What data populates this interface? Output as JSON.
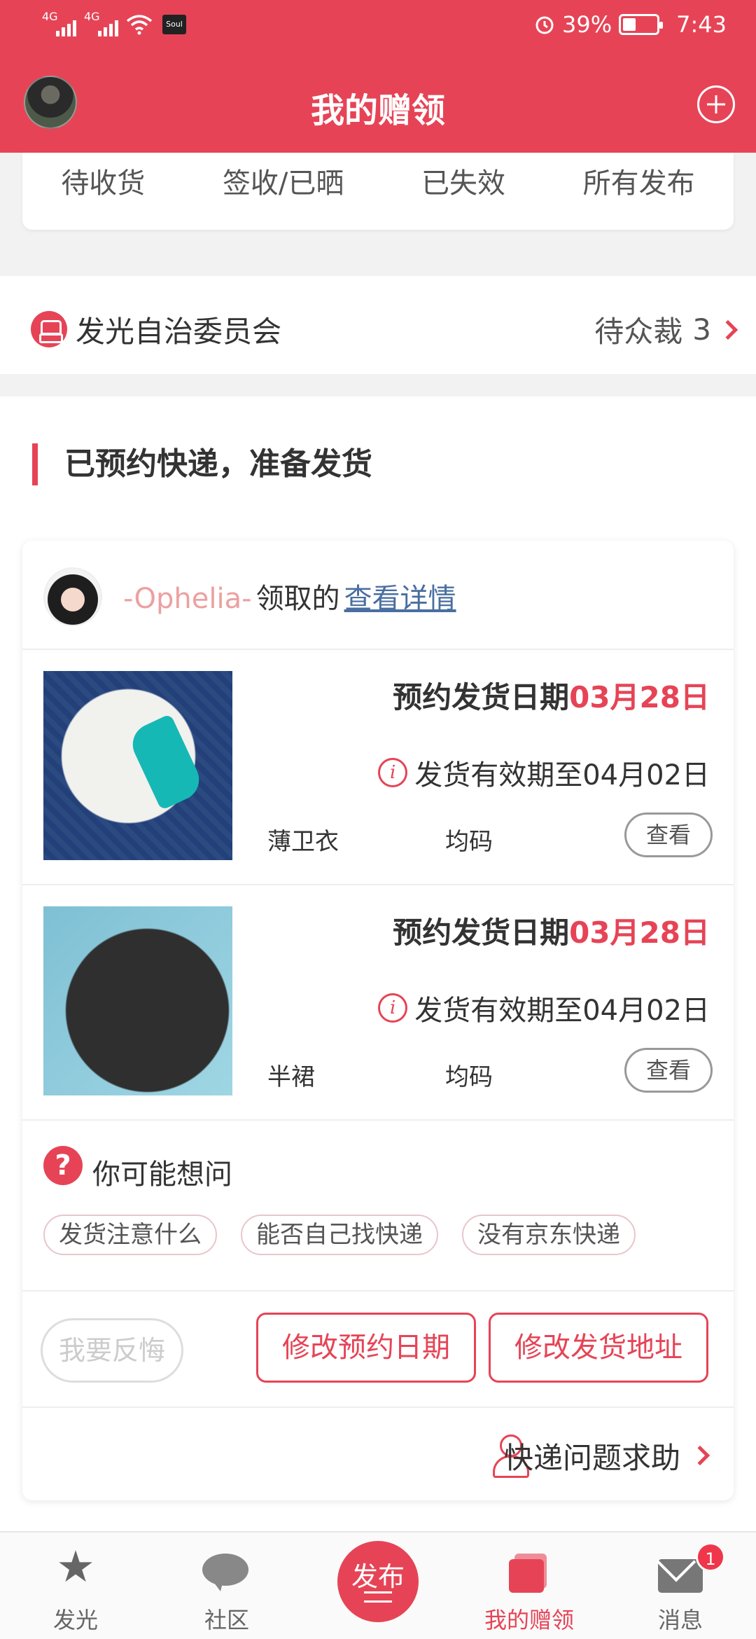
{
  "status_bar": {
    "network1": "4G",
    "network2": "4G",
    "app_badge": "Soul",
    "battery_percent": "39%",
    "battery_level": 0.39,
    "time": "7:43"
  },
  "header": {
    "title": "我的赠领"
  },
  "tabs": [
    "待收货",
    "签收/已晒",
    "已失效",
    "所有发布"
  ],
  "committee": {
    "title": "发光自治委员会",
    "pending_label": "待众裁",
    "pending_count": "3"
  },
  "section": {
    "title": "已预约快递，准备发货"
  },
  "order": {
    "claimer_name": "-Ophelia-",
    "claimed_text": "领取的",
    "details_link": "查看详情",
    "items": [
      {
        "date_label": "预约发货日期",
        "date": "03月28日",
        "validity": "发货有效期至04月02日",
        "name": "薄卫衣",
        "size": "均码",
        "view_label": "查看"
      },
      {
        "date_label": "预约发货日期",
        "date": "03月28日",
        "validity": "发货有效期至04月02日",
        "name": "半裙",
        "size": "均码",
        "view_label": "查看"
      }
    ],
    "faq": {
      "icon": "?",
      "title": "你可能想问",
      "chips": [
        "发货注意什么",
        "能否自己找快递",
        "没有京东快递"
      ]
    },
    "actions": {
      "regret": "我要反悔",
      "change_date": "修改预约日期",
      "change_address": "修改发货地址"
    },
    "help": "快递问题求助"
  },
  "bottom_nav": {
    "items": [
      "发光",
      "社区",
      "我的赠领",
      "消息"
    ],
    "publish_label": "发布",
    "messages_badge": "1",
    "star_glyph": "★"
  },
  "colors": {
    "accent": "#e64456",
    "link": "#4a6ea0",
    "claimer_name": "#eda0a0"
  }
}
